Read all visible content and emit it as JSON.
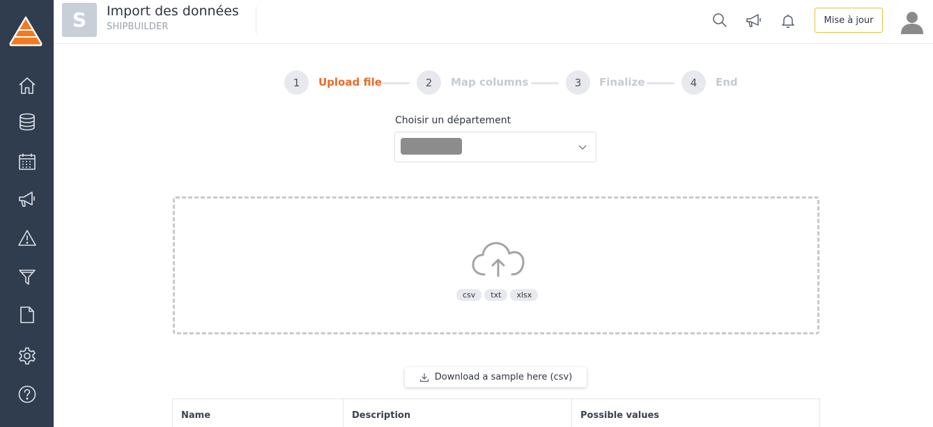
{
  "header": {
    "avatar_letter": "S",
    "title": "Import des données",
    "subtitle": "SHIPBUILDER",
    "update_button": "Mise à jour"
  },
  "sidebar": {
    "items": [
      {
        "icon": "home-icon"
      },
      {
        "icon": "database-icon"
      },
      {
        "icon": "calendar-icon"
      },
      {
        "icon": "megaphone-icon"
      },
      {
        "icon": "warning-icon"
      },
      {
        "icon": "filter-icon"
      },
      {
        "icon": "document-icon"
      },
      {
        "icon": "gear-icon"
      },
      {
        "icon": "help-icon"
      }
    ]
  },
  "stepper": {
    "steps": [
      {
        "number": "1",
        "label": "Upload file",
        "active": true
      },
      {
        "number": "2",
        "label": "Map columns",
        "active": false
      },
      {
        "number": "3",
        "label": "Finalize",
        "active": false
      },
      {
        "number": "4",
        "label": "End",
        "active": false
      }
    ]
  },
  "department": {
    "label": "Choisir un département"
  },
  "dropzone": {
    "tags": [
      "csv",
      "txt",
      "xlsx"
    ]
  },
  "download": {
    "label": "Download a sample here (csv)"
  },
  "table": {
    "columns": [
      "Name",
      "Description",
      "Possible values"
    ]
  },
  "colors": {
    "sidebar_bg": "#2f3d4f",
    "accent_orange": "#e8692a",
    "inactive_step": "#c6cad3",
    "update_border": "#e4c340"
  }
}
